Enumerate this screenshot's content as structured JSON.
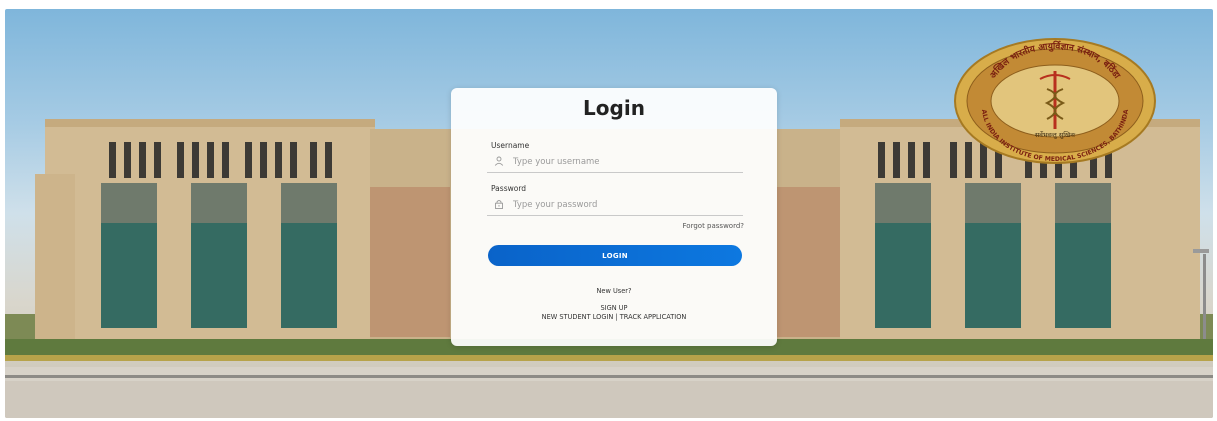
{
  "login": {
    "title": "Login",
    "username_label": "Username",
    "username_placeholder": "Type your username",
    "username_value": "",
    "password_label": "Password",
    "password_placeholder": "Type your password",
    "password_value": "",
    "forgot_link": "Forgot password?",
    "login_button": "LOGIN",
    "new_user_text": "New User?",
    "sign_up_link": "SIGN UP",
    "new_student_login_link": "NEW STUDENT LOGIN",
    "link_separator": "|",
    "track_application_link": "TRACK APPLICATION"
  },
  "emblem": {
    "text_upper": "अखिल भारतीय आयुर्विज्ञान संस्थान, बठिंडा",
    "text_lower": "ALL INDIA INSTITUTE OF MEDICAL SCIENCES, BATHINDA",
    "motto": "सर्वेभवन्तु सुखिनः"
  },
  "icons": {
    "username": "user-icon",
    "password": "lock-icon"
  },
  "colors": {
    "accent": "#0a63c9",
    "card_bg": "#ffffff",
    "emblem_gold": "#d8ad4a",
    "emblem_red": "#b8301e"
  }
}
